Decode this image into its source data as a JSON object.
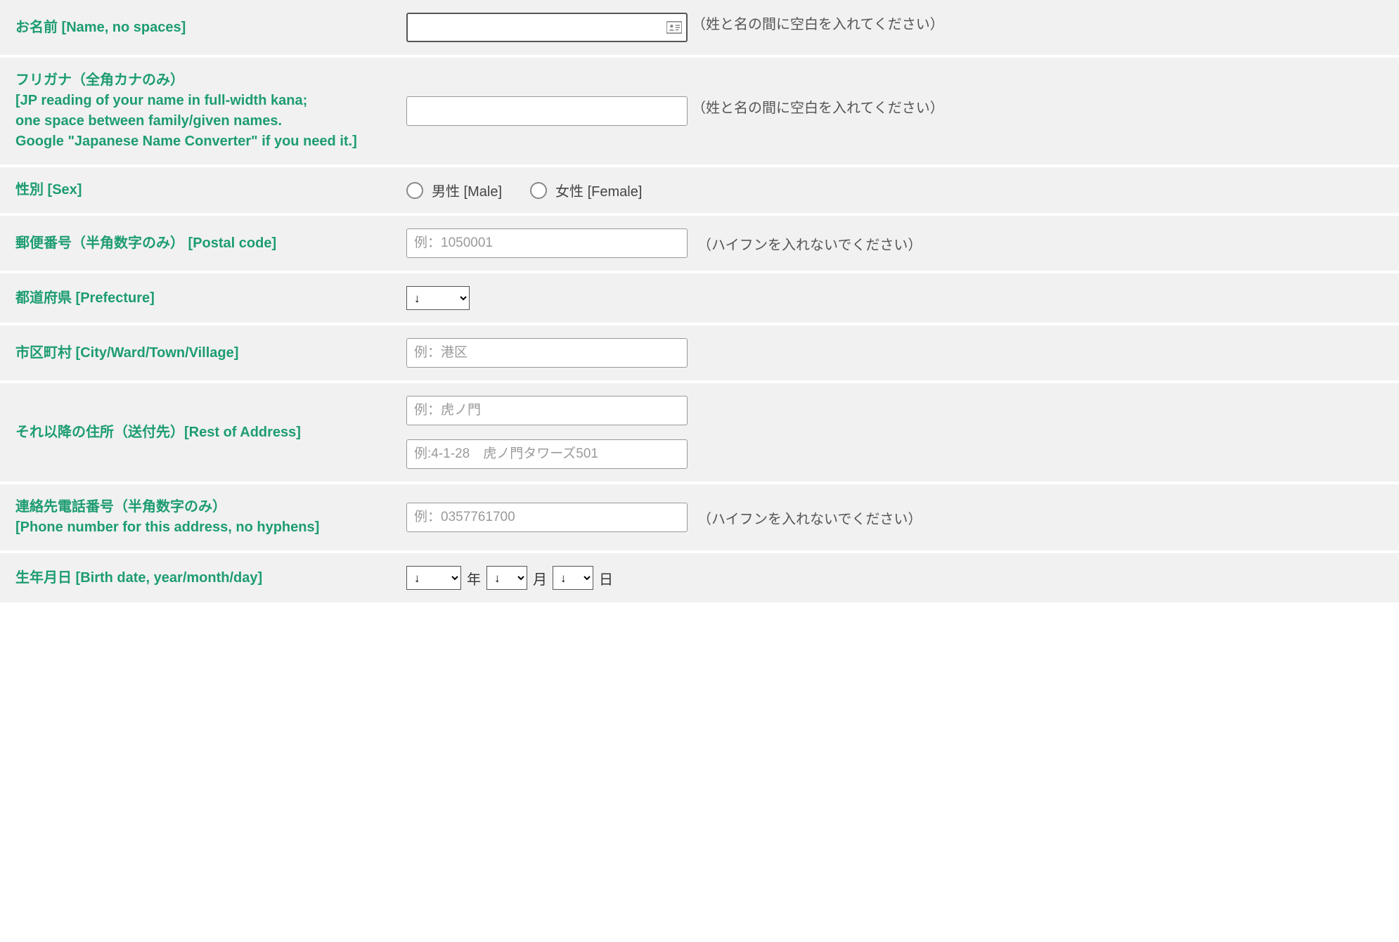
{
  "fields": {
    "name": {
      "label": "お名前 [Name, no spaces]",
      "hint": "（姓と名の間に空白を入れてください）",
      "value": ""
    },
    "furigana": {
      "label_line1": "フリガナ（全角カナのみ）",
      "label_line2": "[JP reading of your name in full-width kana;",
      "label_line3": "one space between family/given names.",
      "label_line4": "Google \"Japanese Name Converter\" if you need it.]",
      "hint": "（姓と名の間に空白を入れてください）",
      "value": ""
    },
    "sex": {
      "label": "性別 [Sex]",
      "male": "男性 [Male]",
      "female": "女性 [Female]"
    },
    "postal": {
      "label": "郵便番号（半角数字のみ） [Postal code]",
      "placeholder": "例：1050001",
      "hint": "（ハイフンを入れないでください）"
    },
    "prefecture": {
      "label": "都道府県 [Prefecture]",
      "selected": "↓"
    },
    "city": {
      "label": "市区町村 [City/Ward/Town/Village]",
      "placeholder": "例：港区"
    },
    "address": {
      "label": "それ以降の住所（送付先）[Rest of Address]",
      "placeholder1": "例：虎ノ門",
      "placeholder2": "例:4-1-28　虎ノ門タワーズ501"
    },
    "phone": {
      "label_line1": "連絡先電話番号（半角数字のみ）",
      "label_line2": "[Phone number for this address, no hyphens]",
      "placeholder": "例：0357761700",
      "hint": "（ハイフンを入れないでください）"
    },
    "dob": {
      "label": "生年月日 [Birth date, year/month/day]",
      "year_sel": "↓",
      "year_unit": "年",
      "month_sel": "↓",
      "month_unit": "月",
      "day_sel": "↓",
      "day_unit": "日"
    }
  }
}
